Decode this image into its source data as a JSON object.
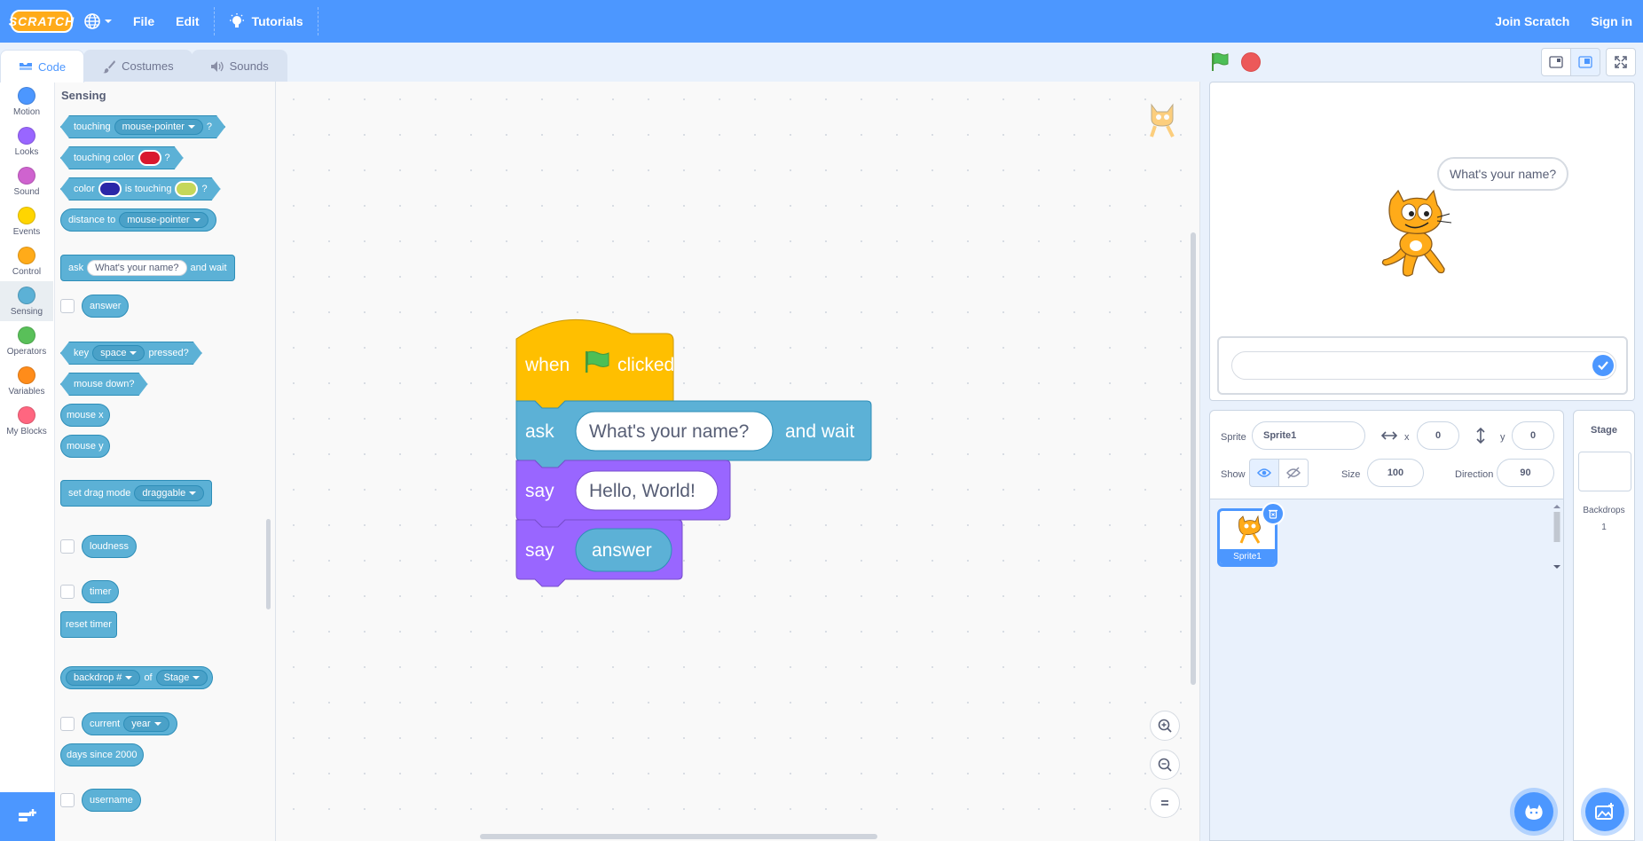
{
  "menubar": {
    "logo": "SCRATCH",
    "file": "File",
    "edit": "Edit",
    "tutorials": "Tutorials",
    "join": "Join Scratch",
    "signin": "Sign in"
  },
  "tabs": [
    {
      "label": "Code",
      "icon": "code-icon"
    },
    {
      "label": "Costumes",
      "icon": "brush-icon"
    },
    {
      "label": "Sounds",
      "icon": "speaker-icon"
    }
  ],
  "categories": [
    {
      "label": "Motion",
      "color": "#4c97ff"
    },
    {
      "label": "Looks",
      "color": "#9966ff"
    },
    {
      "label": "Sound",
      "color": "#cf63cf"
    },
    {
      "label": "Events",
      "color": "#ffd500"
    },
    {
      "label": "Control",
      "color": "#ffab19"
    },
    {
      "label": "Sensing",
      "color": "#5cb1d6"
    },
    {
      "label": "Operators",
      "color": "#59c059"
    },
    {
      "label": "Variables",
      "color": "#ff8c1a"
    },
    {
      "label": "My Blocks",
      "color": "#ff6680"
    }
  ],
  "palette": {
    "title": "Sensing",
    "touching": "touching",
    "mouse_pointer": "mouse-pointer",
    "q": "?",
    "touching_color": "touching color",
    "color": "color",
    "is_touching": "is touching",
    "distance_to": "distance to",
    "ask": "ask",
    "ask_default": "What's your name?",
    "and_wait": "and wait",
    "answer": "answer",
    "key": "key",
    "space": "space",
    "pressed": "pressed?",
    "mouse_down": "mouse down?",
    "mouse_x": "mouse x",
    "mouse_y": "mouse y",
    "set_drag_mode": "set drag mode",
    "draggable": "draggable",
    "loudness": "loudness",
    "timer": "timer",
    "reset_timer": "reset timer",
    "backdrop_num": "backdrop #",
    "of": "of",
    "stage": "Stage",
    "current": "current",
    "year": "year",
    "days_since": "days since 2000",
    "username": "username",
    "colors": {
      "red": "#d9182e",
      "navy": "#2a27a8",
      "lime": "#c5d75a"
    }
  },
  "script": {
    "hat": {
      "when": "when",
      "clicked": "clicked"
    },
    "ask": {
      "label": "ask",
      "value": "What's your name?",
      "suffix": "and wait"
    },
    "say1": {
      "label": "say",
      "value": "Hello, World!"
    },
    "say2": {
      "label": "say",
      "reporter": "answer"
    }
  },
  "stage": {
    "bubble": "What's your name?"
  },
  "sprite_info": {
    "sprite_label": "Sprite",
    "sprite_name": "Sprite1",
    "x_label": "x",
    "x": "0",
    "y_label": "y",
    "y": "0",
    "show_label": "Show",
    "size_label": "Size",
    "size": "100",
    "direction_label": "Direction",
    "direction": "90"
  },
  "sprite_list": [
    {
      "name": "Sprite1"
    }
  ],
  "stage_pane": {
    "title": "Stage",
    "backdrops_label": "Backdrops",
    "backdrops_count": "1"
  }
}
